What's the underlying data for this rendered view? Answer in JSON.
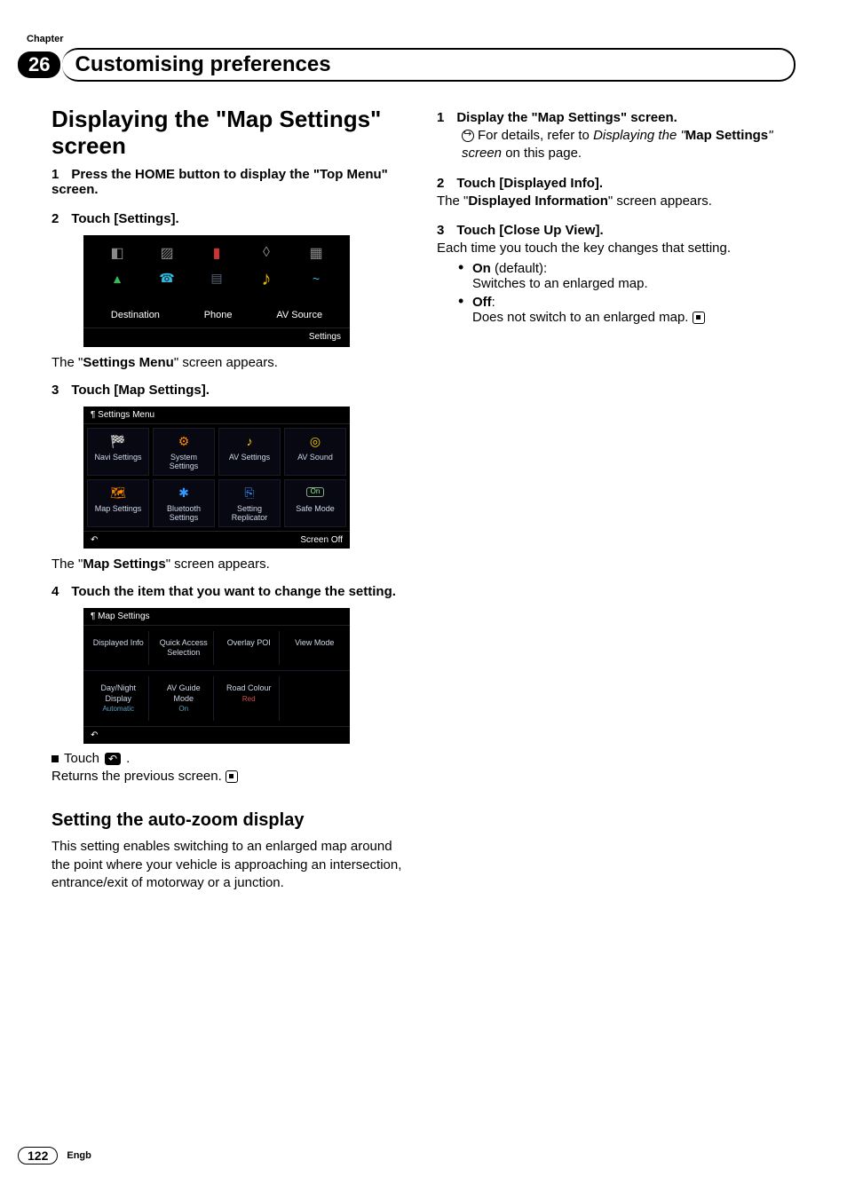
{
  "chapter_label": "Chapter",
  "chapter_number": "26",
  "header_title": "Customising preferences",
  "left": {
    "h2_pre": "Displaying the \"",
    "h2_ref": "Map Settings",
    "h2_post": "\" screen",
    "step1_num": "1",
    "step1_txt": "Press the HOME button to display the \"Top Menu\" screen.",
    "step2_num": "2",
    "step2_txt": "Touch [Settings].",
    "after_ss1_pre": "The \"",
    "after_ss1_bold": "Settings Menu",
    "after_ss1_post": "\" screen appears.",
    "step3_num": "3",
    "step3_txt": "Touch [Map Settings].",
    "after_ss2_pre": "The \"",
    "after_ss2_bold": "Map Settings",
    "after_ss2_post": "\" screen appears.",
    "step4_num": "4",
    "step4_txt": "Touch the item that you want to change the setting.",
    "touch_word": "Touch ",
    "touch_period": ".",
    "returns_text": "Returns the previous screen.",
    "sub_heading": "Setting the auto-zoom display",
    "sub_body": "This setting enables switching to an enlarged map around the point where your vehicle is approaching an intersection, entrance/exit of motorway or a junction."
  },
  "topmenu": {
    "labels": [
      "Destination",
      "Phone",
      "AV Source"
    ],
    "settings": "Settings"
  },
  "settings_menu": {
    "title": "Settings Menu",
    "tiles": [
      {
        "label": "Navi Settings",
        "icon": "🏁"
      },
      {
        "label": "System Settings",
        "icon": "⚙"
      },
      {
        "label": "AV Settings",
        "icon": "♪"
      },
      {
        "label": "AV Sound",
        "icon": "◎"
      },
      {
        "label": "Map Settings",
        "icon": "🗺"
      },
      {
        "label": "Bluetooth Settings",
        "icon": "✱"
      },
      {
        "label": "Setting Replicator",
        "icon": "⎘"
      },
      {
        "label": "Safe Mode",
        "icon": "",
        "badge": "On"
      }
    ],
    "back": "↶",
    "screen_off": "Screen Off"
  },
  "map_settings": {
    "title": "Map Settings",
    "row1": [
      {
        "label": "Displayed Info",
        "sub": ""
      },
      {
        "label": "Quick Access Selection",
        "sub": ""
      },
      {
        "label": "Overlay POI",
        "sub": ""
      },
      {
        "label": "View Mode",
        "sub": ""
      }
    ],
    "row2": [
      {
        "label": "Day/Night Display",
        "sub": "Automatic"
      },
      {
        "label": "AV Guide Mode",
        "sub": "On"
      },
      {
        "label": "Road Colour",
        "sub": "Red"
      },
      {
        "label": "",
        "sub": ""
      }
    ],
    "back": "↶"
  },
  "right": {
    "step1_num": "1",
    "step1_txt": "Display the \"Map Settings\" screen.",
    "xref_pre": "For details, refer to ",
    "xref_italic1": "Displaying the \"",
    "xref_bold": "Map Settings",
    "xref_italic2": "\" screen",
    "xref_post": " on this page.",
    "step2_num": "2",
    "step2_txt": "Touch [Displayed Info].",
    "step2_body_pre": "The \"",
    "step2_body_bold": "Displayed Information",
    "step2_body_post": "\" screen appears.",
    "step3_num": "3",
    "step3_txt": "Touch [Close Up View].",
    "step3_body": "Each time you touch the key changes that setting.",
    "opts": [
      {
        "name": "On",
        "paren": " (default):",
        "desc": "Switches to an enlarged map."
      },
      {
        "name": "Off",
        "paren": ":",
        "desc": "Does not switch to an enlarged map."
      }
    ]
  },
  "footer": {
    "page": "122",
    "lang": "Engb"
  }
}
